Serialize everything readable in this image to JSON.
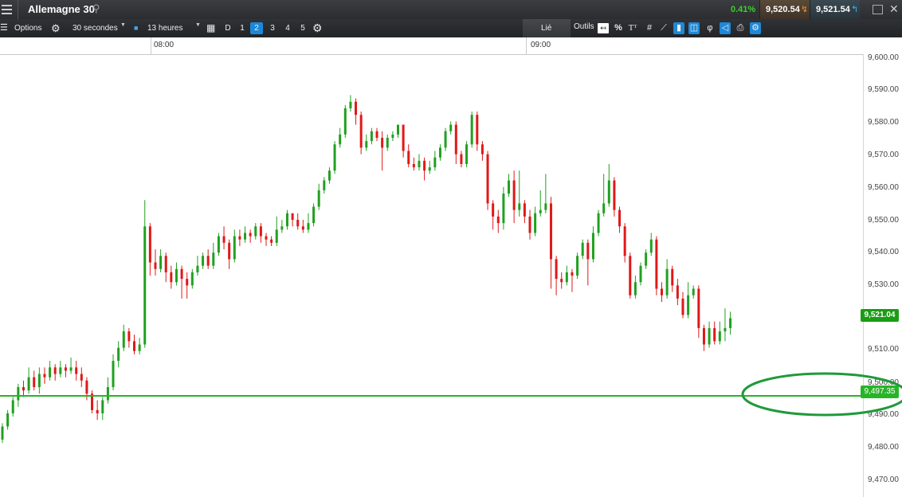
{
  "titlebar": {
    "instrument": "Allemagne 30",
    "change": "0.41%",
    "bid": "9,520.54",
    "ask": "9,521.54",
    "colors": {
      "change": "#3fcf2a",
      "bid_arrow": "#e8952a",
      "ask_arrow": "#2fb7ef"
    }
  },
  "toolbar": {
    "options_label": "Options",
    "interval": "30 secondes",
    "period": "13 heures",
    "d_label": "D",
    "numbers": [
      "1",
      "2",
      "3",
      "4",
      "5"
    ],
    "active_number": "2",
    "linked_label": "Lié",
    "tools_label": "Outils",
    "percent": "%"
  },
  "time_axis": {
    "labels": [
      "08:00",
      "09:00"
    ]
  },
  "price_axis": {
    "labels": [
      "9,600.00",
      "9,590.00",
      "9,580.00",
      "9,570.00",
      "9,560.00",
      "9,550.00",
      "9,540.00",
      "9,530.00",
      "9,510.00",
      "9,500.00",
      "9,490.00",
      "9,480.00",
      "9,470.00"
    ]
  },
  "current_price": {
    "label": "9,521.04",
    "value": 9521.04,
    "color": "#1a9c16"
  },
  "horizontal_line": {
    "label": "9,497.35",
    "value": 9497.35,
    "color": "#28b428"
  },
  "annotation": {
    "type": "ellipse",
    "color": "#1f9a3a"
  },
  "chart_data": {
    "type": "candlestick",
    "ylim": [
      9466.5,
      9601.5
    ],
    "up_color": "#20a020",
    "down_color": "#e01818",
    "series": [
      {
        "name": "",
        "values": [
          [
            9484,
            9488,
            9483,
            9489
          ],
          [
            9488,
            9492,
            9487,
            9493
          ],
          [
            9492,
            9496,
            9491,
            9497
          ],
          [
            9496,
            9500,
            9494,
            9501
          ],
          [
            9500,
            9499,
            9497,
            9502
          ],
          [
            9499,
            9503,
            9498,
            9506
          ],
          [
            9503,
            9500,
            9499,
            9505
          ],
          [
            9500,
            9504,
            9498,
            9506
          ],
          [
            9504,
            9503,
            9501,
            9506
          ],
          [
            9503,
            9506,
            9502,
            9508
          ],
          [
            9506,
            9504,
            9502,
            9507
          ],
          [
            9504,
            9506,
            9503,
            9508
          ],
          [
            9506,
            9505,
            9503,
            9507
          ],
          [
            9505,
            9506,
            9504,
            9509
          ],
          [
            9506,
            9504,
            9502,
            9508
          ],
          [
            9504,
            9502,
            9500,
            9506
          ],
          [
            9502,
            9498,
            9496,
            9503
          ],
          [
            9498,
            9493,
            9492,
            9499
          ],
          [
            9493,
            9492,
            9490,
            9496
          ],
          [
            9492,
            9496,
            9490,
            9497
          ],
          [
            9496,
            9500,
            9495,
            9503
          ],
          [
            9500,
            9508,
            9499,
            9510
          ],
          [
            9508,
            9512,
            9506,
            9514
          ],
          [
            9512,
            9517,
            9511,
            9519
          ],
          [
            9517,
            9514,
            9512,
            9518
          ],
          [
            9514,
            9511,
            9510,
            9516
          ],
          [
            9511,
            9513,
            9510,
            9515
          ],
          [
            9513,
            9549,
            9512,
            9557
          ],
          [
            9549,
            9538,
            9534,
            9550
          ],
          [
            9538,
            9536,
            9534,
            9542
          ],
          [
            9536,
            9540,
            9535,
            9542
          ],
          [
            9540,
            9535,
            9532,
            9541
          ],
          [
            9535,
            9532,
            9530,
            9537
          ],
          [
            9532,
            9536,
            9531,
            9538
          ],
          [
            9536,
            9533,
            9527,
            9537
          ],
          [
            9533,
            9531,
            9527,
            9535
          ],
          [
            9531,
            9535,
            9530,
            9536
          ],
          [
            9535,
            9537,
            9534,
            9540
          ],
          [
            9537,
            9540,
            9536,
            9541
          ],
          [
            9540,
            9537,
            9536,
            9542
          ],
          [
            9537,
            9541,
            9536,
            9544
          ],
          [
            9541,
            9546,
            9540,
            9547
          ],
          [
            9546,
            9544,
            9542,
            9549
          ],
          [
            9544,
            9539,
            9536,
            9545
          ],
          [
            9539,
            9546,
            9538,
            9548
          ],
          [
            9546,
            9545,
            9543,
            9548
          ],
          [
            9545,
            9547,
            9544,
            9549
          ],
          [
            9547,
            9546,
            9544,
            9548
          ],
          [
            9546,
            9549,
            9545,
            9550
          ],
          [
            9549,
            9546,
            9544,
            9550
          ],
          [
            9546,
            9545,
            9543,
            9547
          ],
          [
            9545,
            9544,
            9543,
            9546
          ],
          [
            9544,
            9548,
            9543,
            9552
          ],
          [
            9548,
            9549,
            9547,
            9551
          ],
          [
            9549,
            9553,
            9548,
            9554
          ],
          [
            9553,
            9551,
            9549,
            9553
          ],
          [
            9551,
            9549,
            9548,
            9553
          ],
          [
            9549,
            9548,
            9547,
            9551
          ],
          [
            9548,
            9550,
            9547,
            9553
          ],
          [
            9550,
            9555,
            9549,
            9556
          ],
          [
            9555,
            9560,
            9554,
            9562
          ],
          [
            9560,
            9563,
            9559,
            9564
          ],
          [
            9563,
            9566,
            9562,
            9567
          ],
          [
            9566,
            9574,
            9565,
            9575
          ],
          [
            9574,
            9577,
            9573,
            9579
          ],
          [
            9577,
            9585,
            9576,
            9586
          ],
          [
            9585,
            9587,
            9584,
            9589
          ],
          [
            9587,
            9583,
            9580,
            9588
          ],
          [
            9583,
            9573,
            9571,
            9584
          ],
          [
            9573,
            9575,
            9572,
            9577
          ],
          [
            9575,
            9578,
            9574,
            9579
          ],
          [
            9578,
            9576,
            9575,
            9579
          ],
          [
            9576,
            9573,
            9566,
            9578
          ],
          [
            9573,
            9576,
            9572,
            9577
          ],
          [
            9576,
            9577,
            9575,
            9578
          ],
          [
            9577,
            9580,
            9576,
            9580
          ],
          [
            9580,
            9572,
            9570,
            9580
          ],
          [
            9572,
            9568,
            9567,
            9574
          ],
          [
            9568,
            9567,
            9566,
            9570
          ],
          [
            9567,
            9569,
            9566,
            9571
          ],
          [
            9569,
            9566,
            9563,
            9570
          ],
          [
            9566,
            9567,
            9565,
            9569
          ],
          [
            9567,
            9570,
            9566,
            9572
          ],
          [
            9570,
            9573,
            9569,
            9574
          ],
          [
            9573,
            9578,
            9572,
            9579
          ],
          [
            9578,
            9580,
            9577,
            9581
          ],
          [
            9580,
            9571,
            9568,
            9581
          ],
          [
            9571,
            9568,
            9567,
            9572
          ],
          [
            9568,
            9574,
            9567,
            9575
          ],
          [
            9574,
            9583,
            9573,
            9584
          ],
          [
            9583,
            9574,
            9572,
            9584
          ],
          [
            9574,
            9571,
            9569,
            9575
          ],
          [
            9571,
            9556,
            9554,
            9572
          ],
          [
            9556,
            9552,
            9548,
            9557
          ],
          [
            9552,
            9550,
            9547,
            9554
          ],
          [
            9550,
            9559,
            9548,
            9561
          ],
          [
            9559,
            9563,
            9558,
            9565
          ],
          [
            9563,
            9554,
            9550,
            9566
          ],
          [
            9554,
            9556,
            9552,
            9566
          ],
          [
            9556,
            9552,
            9550,
            9557
          ],
          [
            9552,
            9547,
            9545,
            9554
          ],
          [
            9547,
            9553,
            9546,
            9555
          ],
          [
            9553,
            9554,
            9552,
            9560
          ],
          [
            9554,
            9556,
            9553,
            9565
          ],
          [
            9556,
            9539,
            9530,
            9558
          ],
          [
            9539,
            9533,
            9528,
            9540
          ],
          [
            9533,
            9532,
            9530,
            9535
          ],
          [
            9532,
            9535,
            9531,
            9537
          ],
          [
            9535,
            9534,
            9529,
            9536
          ],
          [
            9534,
            9540,
            9533,
            9541
          ],
          [
            9540,
            9544,
            9539,
            9545
          ],
          [
            9544,
            9539,
            9531,
            9545
          ],
          [
            9539,
            9547,
            9538,
            9549
          ],
          [
            9547,
            9553,
            9546,
            9554
          ],
          [
            9553,
            9556,
            9552,
            9565
          ],
          [
            9556,
            9563,
            9555,
            9568
          ],
          [
            9563,
            9554,
            9552,
            9564
          ],
          [
            9554,
            9549,
            9547,
            9555
          ],
          [
            9549,
            9540,
            9538,
            9550
          ],
          [
            9540,
            9528,
            9527,
            9541
          ],
          [
            9528,
            9532,
            9527,
            9534
          ],
          [
            9532,
            9537,
            9531,
            9538
          ],
          [
            9537,
            9541,
            9536,
            9542
          ],
          [
            9541,
            9545,
            9540,
            9547
          ],
          [
            9545,
            9530,
            9528,
            9546
          ],
          [
            9530,
            9528,
            9526,
            9532
          ],
          [
            9528,
            9536,
            9527,
            9539
          ],
          [
            9536,
            9531,
            9529,
            9537
          ],
          [
            9531,
            9527,
            9525,
            9533
          ],
          [
            9527,
            9522,
            9521,
            9529
          ],
          [
            9522,
            9528,
            9521,
            9532
          ],
          [
            9528,
            9530,
            9527,
            9531
          ],
          [
            9530,
            9518,
            9515,
            9531
          ],
          [
            9518,
            9513,
            9511,
            9519
          ],
          [
            9513,
            9518,
            9512,
            9520
          ],
          [
            9518,
            9514,
            9513,
            9520
          ],
          [
            9514,
            9517,
            9513,
            9520
          ],
          [
            9517,
            9518,
            9514,
            9524
          ],
          [
            9518,
            9521,
            9516,
            9523
          ]
        ]
      }
    ]
  }
}
